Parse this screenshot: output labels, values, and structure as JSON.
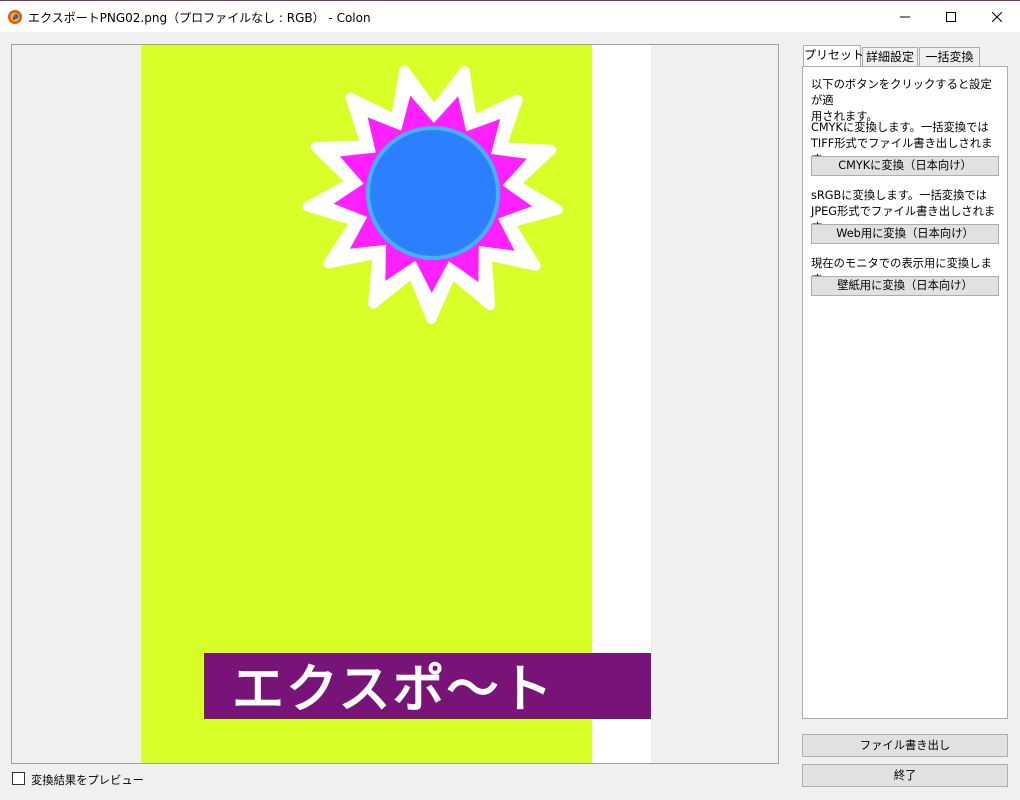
{
  "window": {
    "title": "エクスポートPNG02.png（プロファイルなし : RGB） - Colon",
    "app_icon": "colon-app-icon",
    "controls": [
      "minimize-icon",
      "maximize-icon",
      "close-icon"
    ]
  },
  "preview": {
    "banner_text": "エクスポ〜ト",
    "colors": {
      "pane_background": "#f0f0f0",
      "canvas_green": "#d8ff28",
      "canvas_white": "#ffffff",
      "banner_purple": "#781478",
      "banner_text": "#ffffff",
      "starburst_outline": "#ffffff",
      "starburst_fill": "#ff20ff",
      "circle_ring": "#40b4ff",
      "circle_fill": "#2c80ff"
    }
  },
  "tabs": [
    {
      "label": "プリセット",
      "active": true
    },
    {
      "label": "詳細設定",
      "active": false
    },
    {
      "label": "一括変換",
      "active": false
    }
  ],
  "presets": {
    "intro": "以下のボタンをクリックすると設定が適\n用されます。",
    "cmyk_desc": "CMYKに変換します。一括変換では\nTIFF形式でファイル書き出しされます。",
    "cmyk_button": "CMYKに変換（日本向け）",
    "srgb_desc": "sRGBに変換します。一括変換では\nJPEG形式でファイル書き出しされます。",
    "web_button": "Web用に変換（日本向け）",
    "monitor_desc": "現在のモニタでの表示用に変換します。",
    "wallpaper_button": "壁紙用に変換（日本向け）"
  },
  "footer": {
    "preview_checkbox_label": "変換結果をプレビュー",
    "preview_checked": false,
    "export_button": "ファイル書き出し",
    "exit_button": "終了"
  }
}
